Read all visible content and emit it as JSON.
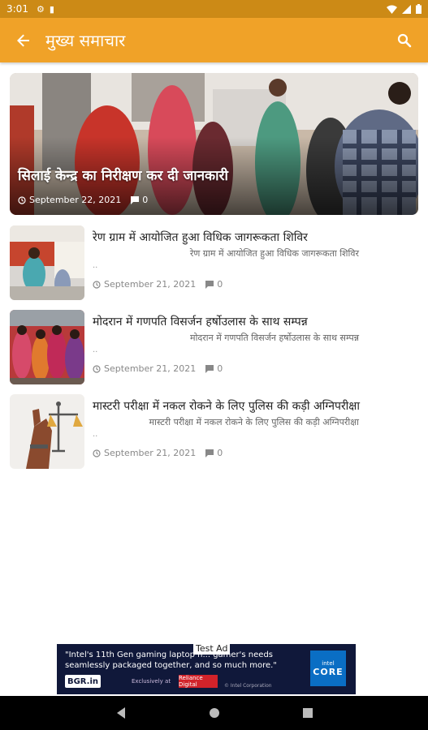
{
  "status_bar": {
    "time": "3:01"
  },
  "app_bar": {
    "title": "मुख्य समाचार"
  },
  "featured": {
    "title": "सिलाई केन्द्र का निरीक्षण कर दी जानकारी",
    "date": "September 22, 2021",
    "comments": "0"
  },
  "articles": [
    {
      "title": "रेण ग्राम में आयोजित हुआ विधिक जागरूकता शिविर",
      "excerpt": "रेण ग्राम में आयोजित हुआ विधिक जागरूकता शिविर",
      "ellipsis": "..",
      "date": "September 21, 2021",
      "comments": "0"
    },
    {
      "title": "मोदरान में गणपति विसर्जन हर्षोउलास के साथ सम्पन्न",
      "excerpt": "मोदरान में गणपति विसर्जन हर्षोउलास के साथ सम्पन्न",
      "ellipsis": "..",
      "date": "September 21, 2021",
      "comments": "0"
    },
    {
      "title": "मास्टरी परीक्षा में नकल रोकने के लिए पुलिस की कड़ी अग्निपरीक्षा",
      "excerpt": "मास्टरी परीक्षा में नकल रोकने के लिए पुलिस की कड़ी अग्निपरीक्षा",
      "ellipsis": "..",
      "date": "September 21, 2021",
      "comments": "0"
    }
  ],
  "ad": {
    "label": "Test Ad",
    "headline": "\"Intel's 11th Gen gaming laptop h... gamer's needs seamlessly packaged together, and so much more.\"",
    "brand": "BGR.in",
    "exclusive": "Exclusively at",
    "store": "Reliance Digital",
    "copyright": "© Intel Corporation",
    "chip_brand": "intel",
    "chip_name": "CORE"
  },
  "colors": {
    "app_bar": "#f0a228",
    "status_bar": "#cc8a16"
  }
}
